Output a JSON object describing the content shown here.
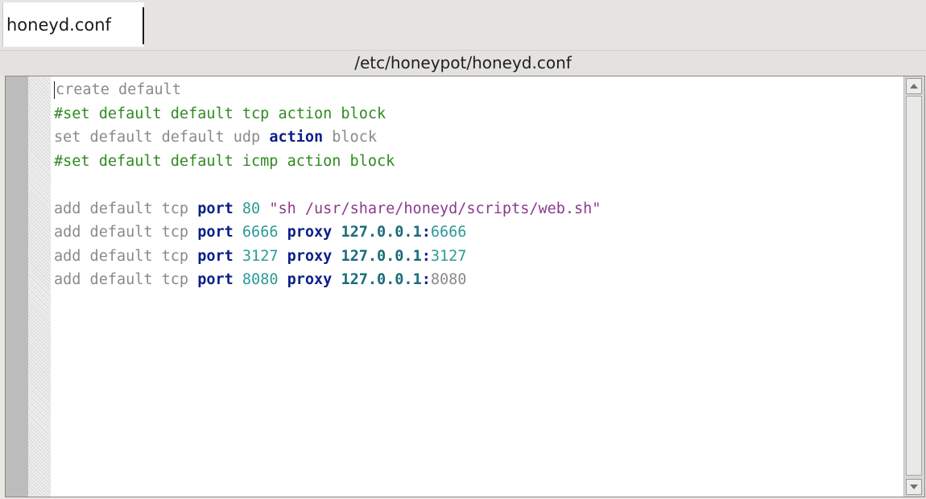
{
  "tabs": [
    {
      "label": "honeyd.conf",
      "active": true
    }
  ],
  "path": "/etc/honeypot/honeyd.conf",
  "colors": {
    "comment": "#2e8b1f",
    "keyword": "#0c1f8a",
    "number": "#2e9a9a",
    "string": "#8b3a8b",
    "plain": "#8a8a8a"
  },
  "editor": {
    "lines": [
      [
        {
          "t": "plain",
          "v": "create default"
        }
      ],
      [
        {
          "t": "comment",
          "v": "#set default default tcp action block"
        }
      ],
      [
        {
          "t": "plain",
          "v": "set default default udp "
        },
        {
          "t": "keyword",
          "v": "action"
        },
        {
          "t": "plain",
          "v": " block"
        }
      ],
      [
        {
          "t": "comment",
          "v": "#set default default icmp action block"
        }
      ],
      [
        {
          "t": "plain",
          "v": ""
        }
      ],
      [
        {
          "t": "plain",
          "v": "add default tcp "
        },
        {
          "t": "keyword",
          "v": "port"
        },
        {
          "t": "plain",
          "v": " "
        },
        {
          "t": "number",
          "v": "80"
        },
        {
          "t": "plain",
          "v": " "
        },
        {
          "t": "string",
          "v": "\"sh /usr/share/honeyd/scripts/web.sh\""
        }
      ],
      [
        {
          "t": "plain",
          "v": "add default tcp "
        },
        {
          "t": "keyword",
          "v": "port"
        },
        {
          "t": "plain",
          "v": " "
        },
        {
          "t": "number",
          "v": "6666"
        },
        {
          "t": "plain",
          "v": " "
        },
        {
          "t": "keyword",
          "v": "proxy"
        },
        {
          "t": "plain",
          "v": " "
        },
        {
          "t": "ip",
          "v": "127.0.0.1"
        },
        {
          "t": "colon",
          "v": ":"
        },
        {
          "t": "number",
          "v": "6666"
        }
      ],
      [
        {
          "t": "plain",
          "v": "add default tcp "
        },
        {
          "t": "keyword",
          "v": "port"
        },
        {
          "t": "plain",
          "v": " "
        },
        {
          "t": "number",
          "v": "3127"
        },
        {
          "t": "plain",
          "v": " "
        },
        {
          "t": "keyword",
          "v": "proxy"
        },
        {
          "t": "plain",
          "v": " "
        },
        {
          "t": "ip",
          "v": "127.0.0.1"
        },
        {
          "t": "colon",
          "v": ":"
        },
        {
          "t": "number",
          "v": "3127"
        }
      ],
      [
        {
          "t": "plain",
          "v": "add default tcp "
        },
        {
          "t": "keyword",
          "v": "port"
        },
        {
          "t": "plain",
          "v": " "
        },
        {
          "t": "number",
          "v": "8080"
        },
        {
          "t": "plain",
          "v": " "
        },
        {
          "t": "keyword",
          "v": "proxy"
        },
        {
          "t": "plain",
          "v": " "
        },
        {
          "t": "ip",
          "v": "127.0.0.1"
        },
        {
          "t": "colon",
          "v": ":"
        },
        {
          "t": "plain",
          "v": "8080"
        }
      ]
    ]
  },
  "scrollbar": {
    "up_icon": "arrow-up-icon",
    "down_icon": "arrow-down-icon"
  }
}
